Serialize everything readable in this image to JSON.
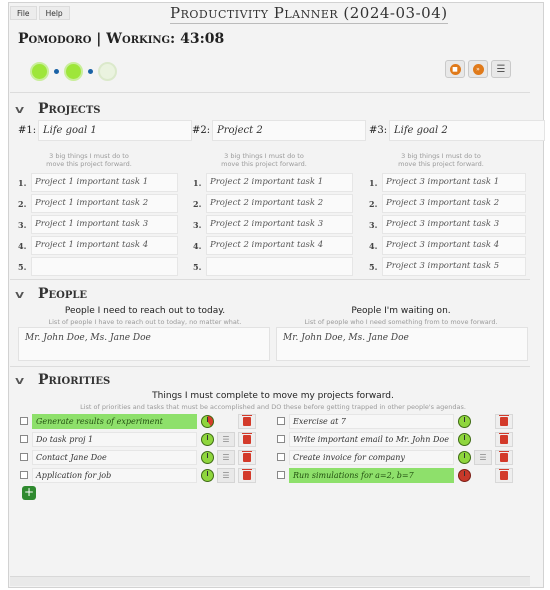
{
  "menu": [
    "File",
    "Help"
  ],
  "app_title": "Productivity Planner (2024-03-04)",
  "pomodoro": {
    "label": "Pomodoro | Working: 43:08",
    "sessions_done": 2,
    "sessions_total": 3
  },
  "sections": {
    "projects": "Projects",
    "people": "People",
    "priorities": "Priorities"
  },
  "projects": [
    {
      "label": "#1:",
      "goal": "Life goal 1",
      "hint": "3 big things I must do to move this project forward.",
      "tasks": [
        "Project 1 important task 1",
        "Project 1 important task 2",
        "Project 1 important task 3",
        "Project 1 important task 4",
        ""
      ]
    },
    {
      "label": "#2:",
      "goal": "Project 2",
      "hint": "3 big things I must do to move this project forward.",
      "tasks": [
        "Project 2 important task 1",
        "Project 2 important task 2",
        "Project 2 important task 3",
        "Project 2 important task 4",
        ""
      ]
    },
    {
      "label": "#3:",
      "goal": "Life goal 2",
      "hint": "3 big things I must do to move this project forward.",
      "tasks": [
        "Project 3 important task 1",
        "Project 3 important task 2",
        "Project 3 important task 3",
        "Project 3 important task 4",
        "Project 3 important task 5"
      ]
    }
  ],
  "task_numbers": [
    "1.",
    "2.",
    "3.",
    "4.",
    "5."
  ],
  "people": {
    "reach_out_title": "People I need to reach out to today.",
    "reach_out_hint": "List of people I have to reach out to today, no matter what.",
    "reach_out_value": "Mr. John Doe,  Ms. Jane Doe",
    "waiting_title": "People I'm waiting on.",
    "waiting_hint": "List of people who I need something from to move forward.",
    "waiting_value": "Mr. John Doe,  Ms. Jane Doe"
  },
  "priorities": {
    "title": "Things I must complete to move my projects forward.",
    "hint": "List of priorities and tasks that must be accomplished and DO these before getting trapped in other people's agendas.",
    "left": [
      {
        "text": "Generate results of experiment",
        "highlight": true,
        "timer": "partial"
      },
      {
        "text": "Do task proj 1",
        "highlight": false,
        "timer": "green"
      },
      {
        "text": "Contact Jane Doe",
        "highlight": false,
        "timer": "green"
      },
      {
        "text": "Application for job",
        "highlight": false,
        "timer": "green"
      }
    ],
    "right": [
      {
        "text": "Exercise at 7",
        "highlight": false,
        "timer": "green"
      },
      {
        "text": "Write important email to Mr. John Doe",
        "highlight": false,
        "timer": "green"
      },
      {
        "text": "Create invoice for company",
        "highlight": false,
        "timer": "green"
      },
      {
        "text": "Run simulations for a=2, b=7",
        "highlight": true,
        "timer": "red"
      }
    ]
  },
  "icons": {
    "collapse": "chevron-down-icon",
    "stop": "stop-icon",
    "skip": "skip-icon",
    "settings": "sliders-icon",
    "timer": "timer-icon",
    "list": "list-icon",
    "delete": "trash-icon",
    "add": "plus-icon"
  },
  "colors": {
    "accent_green": "#8ee06b",
    "danger": "#d33a2a",
    "progress_dot": "#1a62a6"
  }
}
